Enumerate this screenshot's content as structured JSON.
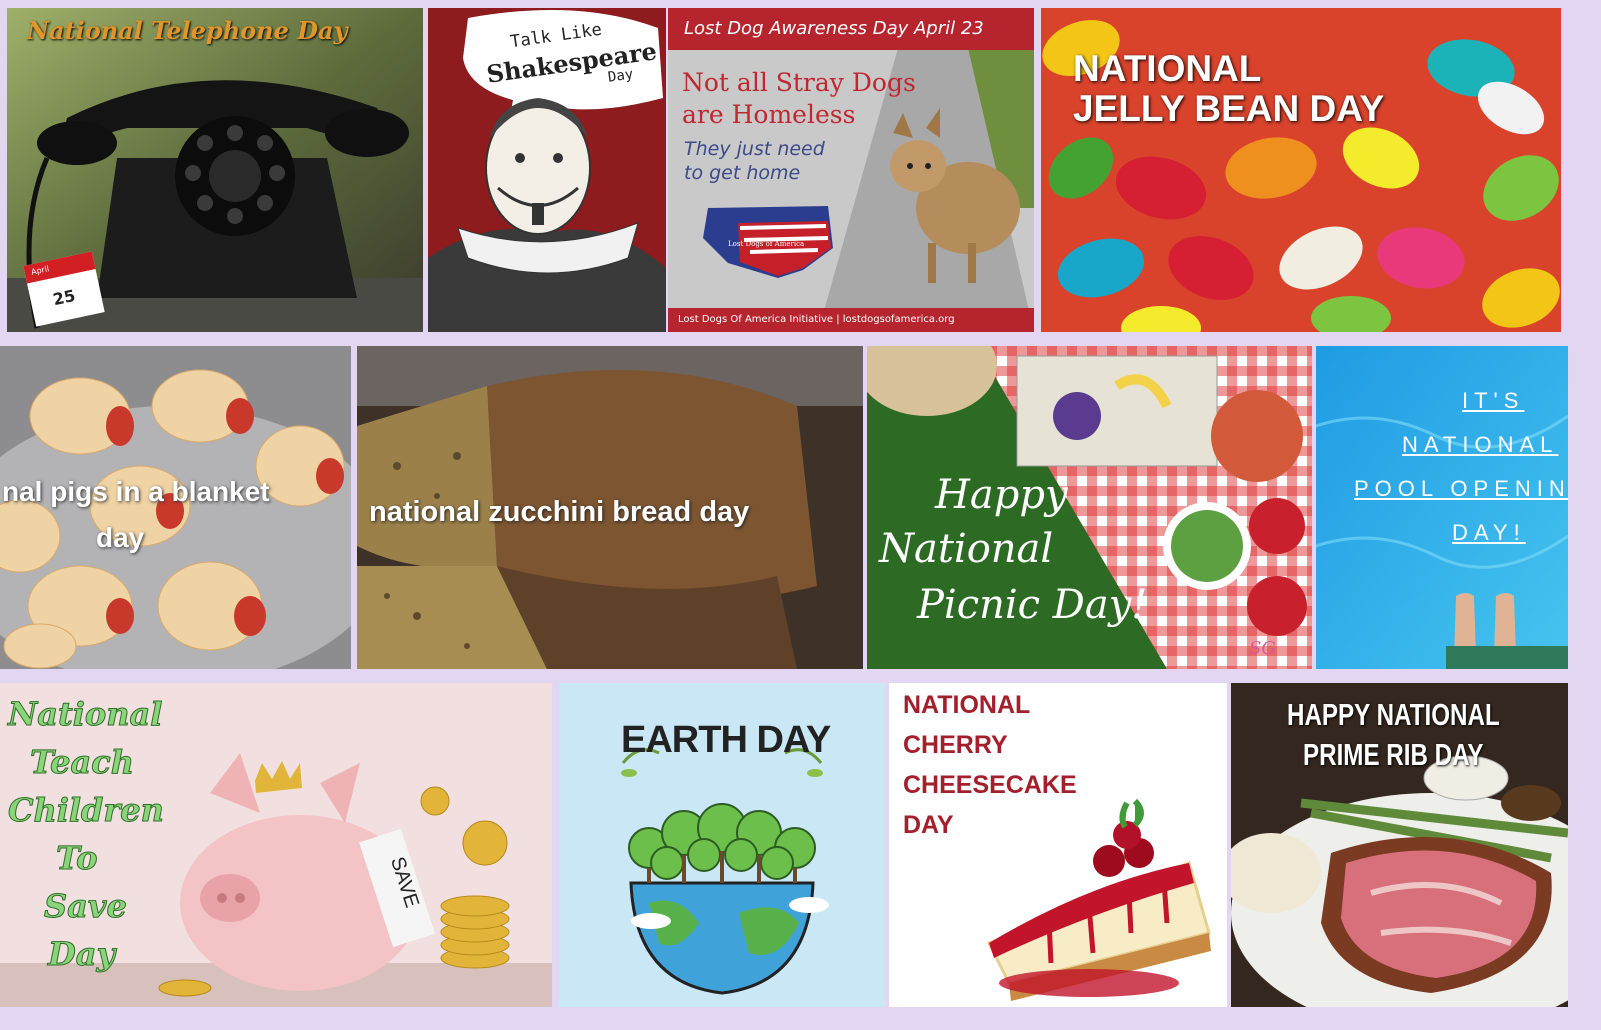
{
  "tiles": {
    "telephone": {
      "title": "National Telephone Day",
      "month": "April",
      "date": "25"
    },
    "shakespeare": {
      "line1": "Talk Like",
      "line2": "Shakespeare",
      "line3": "Day"
    },
    "lost_dog": {
      "banner": "Lost  Dog Awareness Day April 23",
      "headline1": "Not all Stray Dogs",
      "headline2": "are Homeless",
      "sub1": "They just need",
      "sub2": "to get home",
      "map_label": "Lost Dogs of America",
      "footer": "Lost Dogs Of America Initiative  |  lostdogsofamerica.org"
    },
    "jelly_bean": {
      "line1": "NATIONAL",
      "line2": "JELLY BEAN DAY"
    },
    "pigs": {
      "line1": "nal pigs in a blanket",
      "line2": "day"
    },
    "zucchini": {
      "title": "national zucchini bread day"
    },
    "picnic": {
      "line1": "Happy",
      "line2": "National",
      "line3": "Picnic Day!",
      "signature": "SG"
    },
    "pool": {
      "line1": "IT'S",
      "line2": "NATIONAL",
      "line3": "POOL OPENING",
      "line4": "DAY!"
    },
    "teach": {
      "line1": "National",
      "line2": "Teach",
      "line3": "Children",
      "line4": "To",
      "line5": "Save",
      "line6": "Day",
      "tag": "SAVE"
    },
    "earth": {
      "title": "EARTH DAY"
    },
    "cheesecake": {
      "line1": "NATIONAL",
      "line2": "CHERRY",
      "line3": "CHEESECAKE",
      "line4": "DAY"
    },
    "prime_rib": {
      "line1": "HAPPY NATIONAL",
      "line2": "PRIME RIB DAY"
    }
  },
  "colors": {
    "background": "#e3d6f3",
    "shakespeare_red": "#8e1b1e",
    "cheesecake_red": "#a31f2b",
    "teach_green": "#7cc46a"
  }
}
